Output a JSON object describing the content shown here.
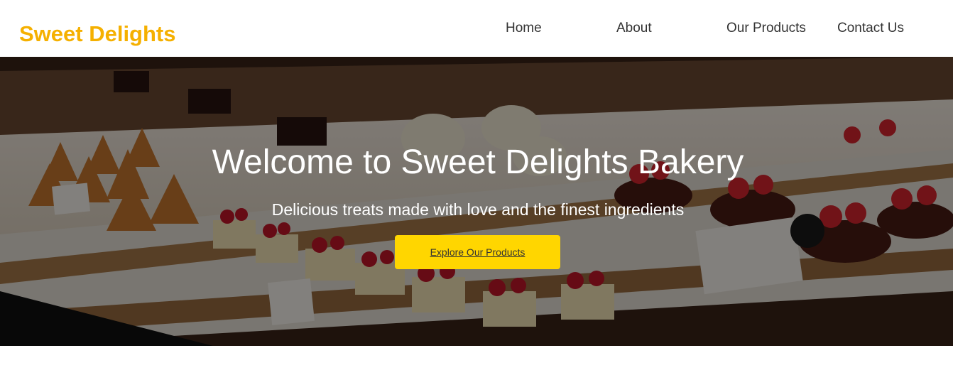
{
  "brand": {
    "name": "Sweet Delights",
    "color": "#f5b000"
  },
  "nav": {
    "items": [
      {
        "label": "Home"
      },
      {
        "label": "About"
      },
      {
        "label": "Our Products"
      },
      {
        "label": "Contact Us"
      }
    ]
  },
  "hero": {
    "title": "Welcome to Sweet Delights Bakery",
    "subtitle": "Delicious treats made with love and the finest ingredients",
    "cta_label": "Explore Our Products",
    "cta_color": "#ffd600",
    "background": "bakery-display-case-photo"
  }
}
